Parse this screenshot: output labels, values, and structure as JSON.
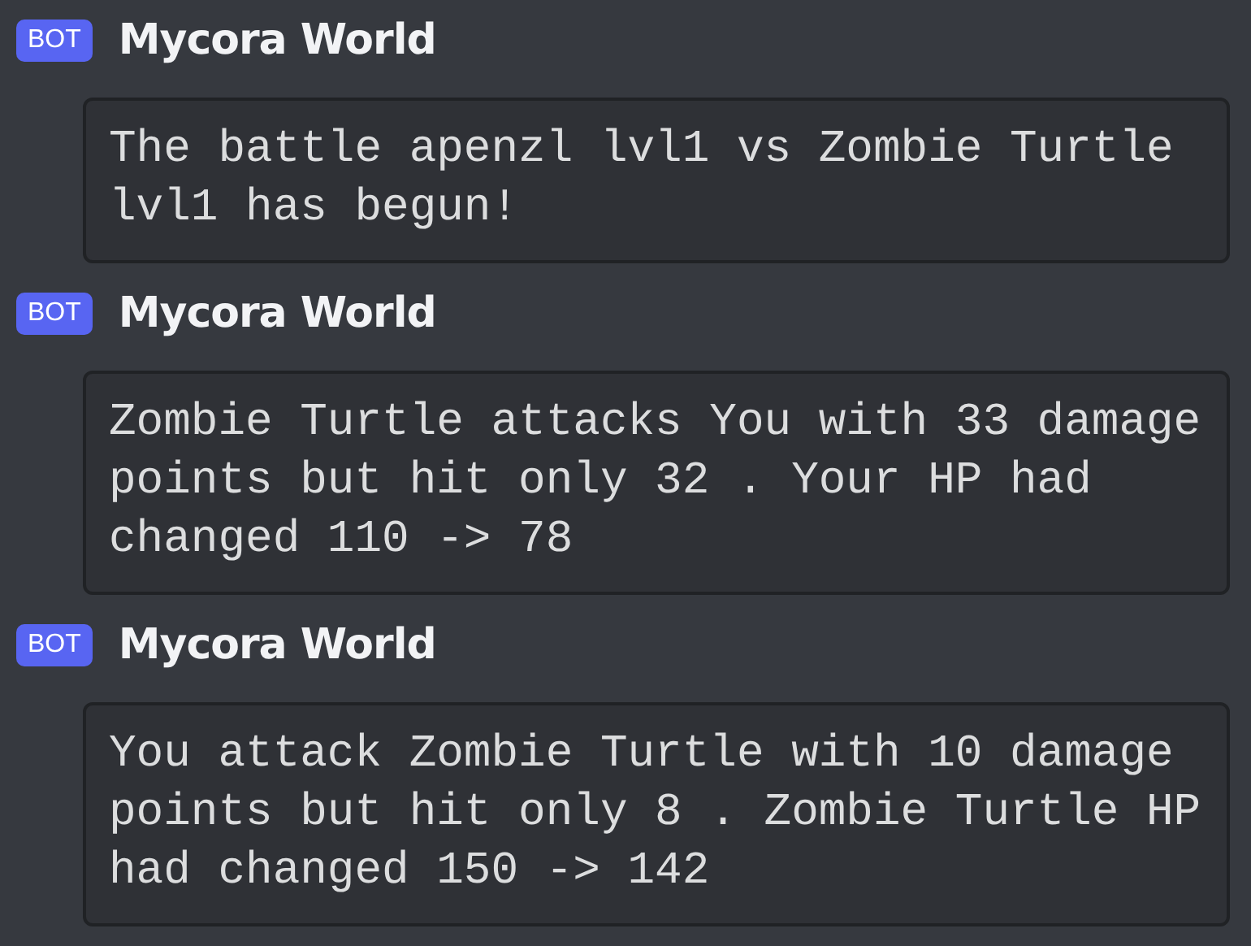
{
  "messages": [
    {
      "badge": "BOT",
      "author": "Mycora World",
      "code": "The battle apenzl lvl1 vs Zombie Turtle lvl1 has begun!"
    },
    {
      "badge": "BOT",
      "author": "Mycora World",
      "code": "Zombie Turtle attacks You with 33 damage points but hit only 32 . Your HP had changed 110 -> 78"
    },
    {
      "badge": "BOT",
      "author": "Mycora World",
      "code": "You attack Zombie Turtle with 10 damage points but hit only 8 . Zombie Turtle HP had changed 150 -> 142"
    }
  ]
}
